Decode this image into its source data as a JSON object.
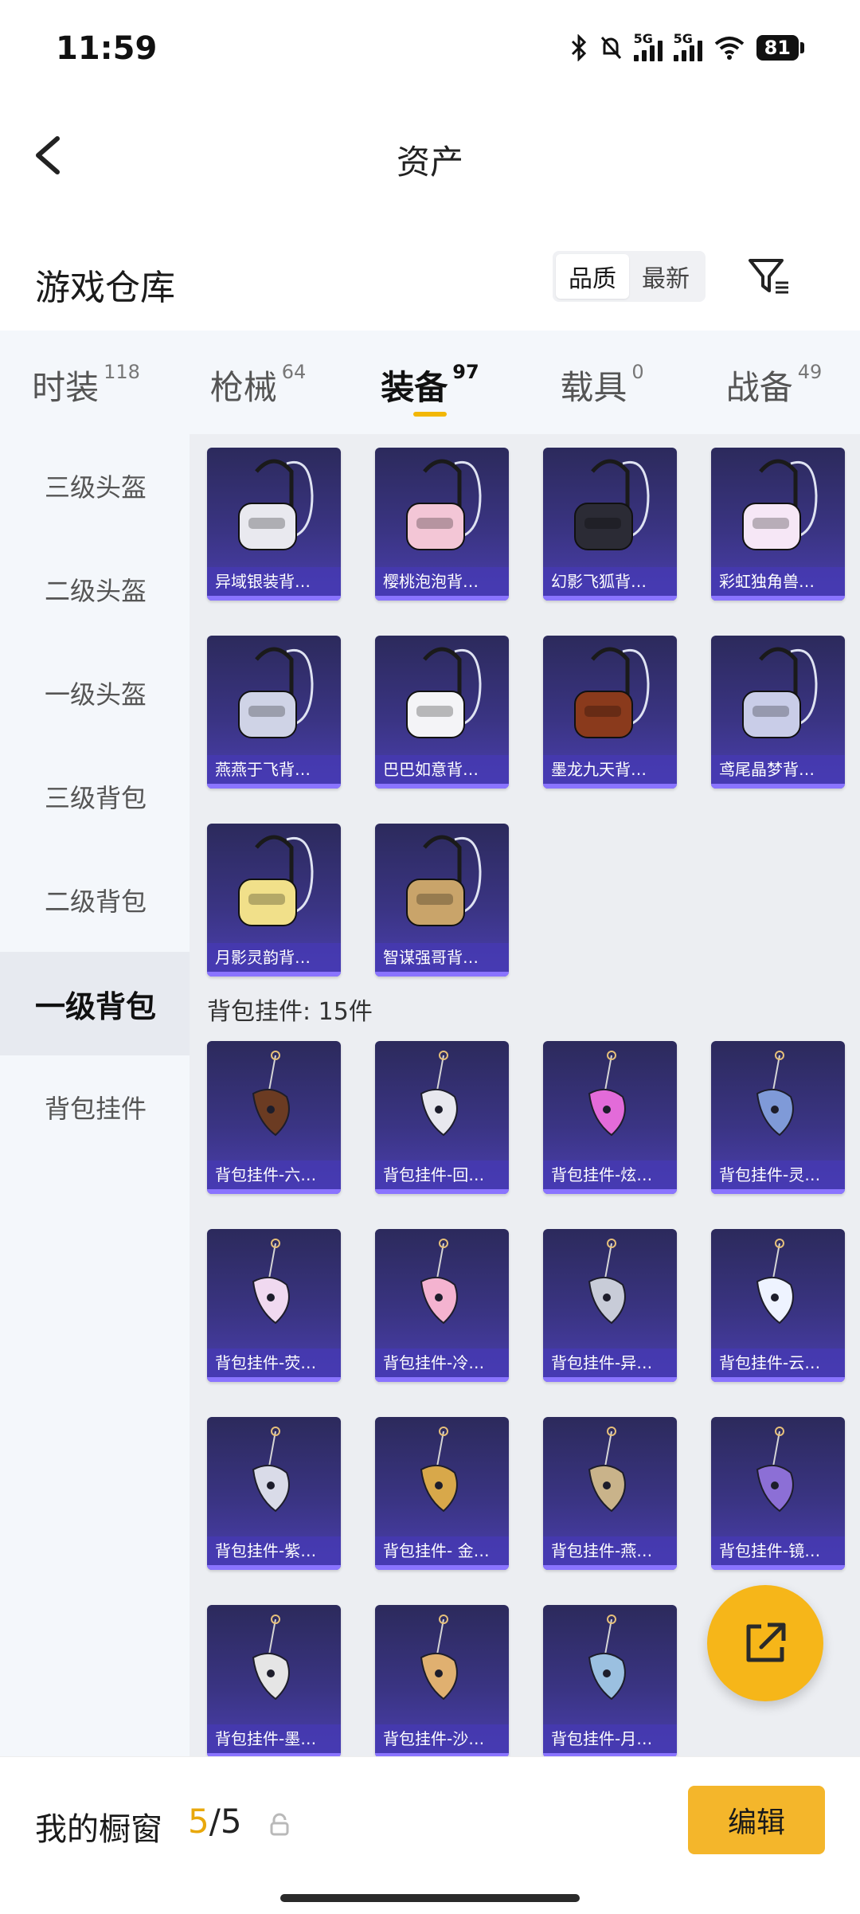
{
  "status_bar": {
    "time": "11:59",
    "net_tag_1": "5G",
    "net_tag_2": "5G",
    "battery": "81"
  },
  "header": {
    "title": "资产"
  },
  "warehouse": {
    "title": "游戏仓库",
    "sort_options": [
      "品质",
      "最新"
    ],
    "sort_selected": "品质"
  },
  "tabs": [
    {
      "label": "时装",
      "count": "118"
    },
    {
      "label": "枪械",
      "count": "64"
    },
    {
      "label": "装备",
      "count": "97",
      "active": true
    },
    {
      "label": "载具",
      "count": "0"
    },
    {
      "label": "战备",
      "count": "49"
    }
  ],
  "sidebar": {
    "items": [
      "三级头盔",
      "二级头盔",
      "一级头盔",
      "三级背包",
      "二级背包",
      "一级背包",
      "背包挂件"
    ],
    "active": "一级背包"
  },
  "backpacks": [
    {
      "name": "异域银装背…",
      "icon": "black-backpack-icon"
    },
    {
      "name": "樱桃泡泡背…",
      "icon": "pink-bow-backpack-icon"
    },
    {
      "name": "幻影飞狐背…",
      "icon": "fox-backpack-icon"
    },
    {
      "name": "彩虹独角兽…",
      "icon": "unicorn-backpack-icon"
    },
    {
      "name": "燕燕于飞背…",
      "icon": "swallow-backpack-icon"
    },
    {
      "name": "巴巴如意背…",
      "icon": "bunny-backpack-icon"
    },
    {
      "name": "墨龙九天背…",
      "icon": "dragon-backpack-icon"
    },
    {
      "name": "鸢尾晶梦背…",
      "icon": "crystal-backpack-icon"
    },
    {
      "name": "月影灵韵背…",
      "icon": "moon-backpack-icon"
    },
    {
      "name": "智谋强哥背…",
      "icon": "bear-backpack-icon"
    }
  ],
  "charms_section": {
    "label": "背包挂件: 15件"
  },
  "charms": [
    {
      "name": "背包挂件-六…",
      "icon": "bird-charm-icon"
    },
    {
      "name": "背包挂件-回…",
      "icon": "windchime-charm-icon"
    },
    {
      "name": "背包挂件-炫…",
      "icon": "candy-charm-icon"
    },
    {
      "name": "背包挂件-灵…",
      "icon": "cat-bottle-charm-icon"
    },
    {
      "name": "背包挂件-荧…",
      "icon": "drink-cup-charm-icon"
    },
    {
      "name": "背包挂件-冷…",
      "icon": "rose-charm-icon"
    },
    {
      "name": "背包挂件-异…",
      "icon": "wing-badge-charm-icon"
    },
    {
      "name": "背包挂件-云…",
      "icon": "penguin-charm-icon"
    },
    {
      "name": "背包挂件-紫…",
      "icon": "bell-charm-icon"
    },
    {
      "name": "背包挂件- 金…",
      "icon": "gold-swirl-charm-icon"
    },
    {
      "name": "背包挂件-燕…",
      "icon": "swallow-charm-icon"
    },
    {
      "name": "背包挂件-镜…",
      "icon": "mirror-charm-icon"
    },
    {
      "name": "背包挂件-墨…",
      "icon": "ink-charm-icon"
    },
    {
      "name": "背包挂件-沙…",
      "icon": "sand-crystal-charm-icon"
    },
    {
      "name": "背包挂件-月…",
      "icon": "rabbit-charm-icon"
    }
  ],
  "bottom_bar": {
    "label": "我的橱窗",
    "count_current": "5",
    "count_total": "/5",
    "edit_label": "编辑"
  },
  "colors": {
    "accent": "#f4b62b",
    "card_top": "#2c2a5c",
    "card_bottom": "#4b3fb0"
  }
}
